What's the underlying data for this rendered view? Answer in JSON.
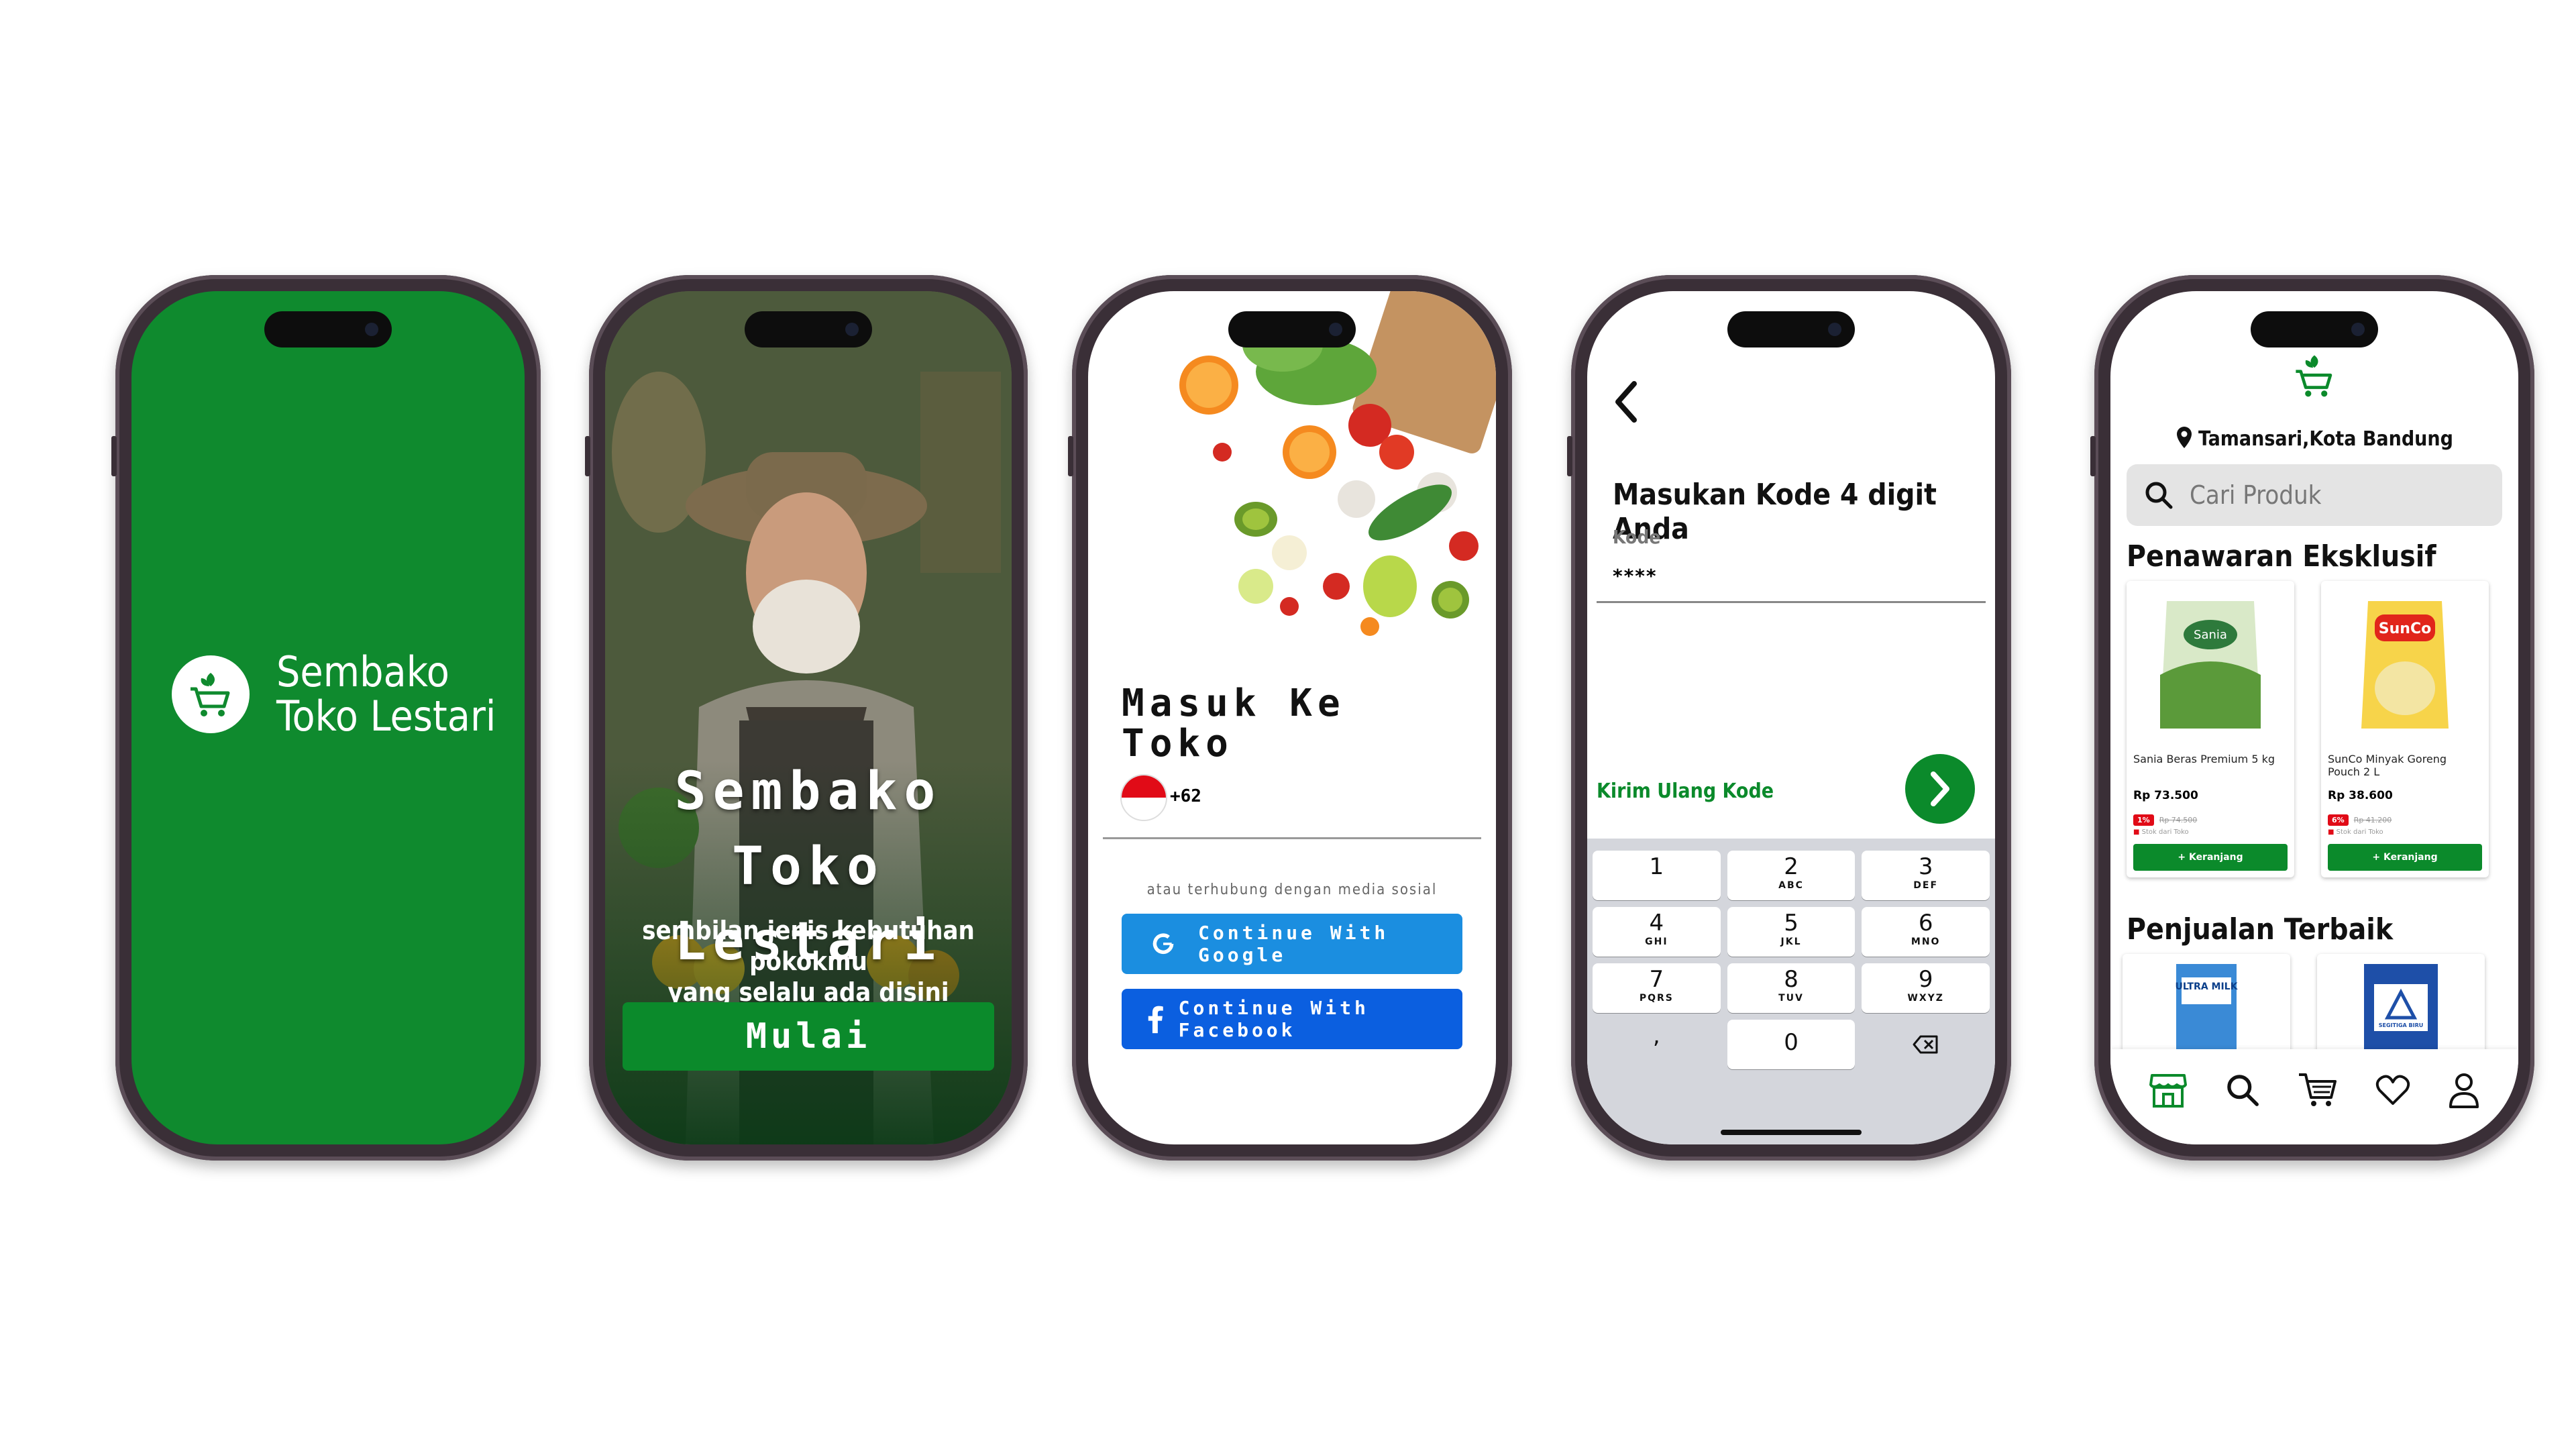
{
  "splash": {
    "brand_line1": "Sembako",
    "brand_line2": "Toko Lestari",
    "logo_icon": "cart-leaf-icon"
  },
  "onboarding": {
    "title_line1": "Sembako",
    "title_line2": "Toko Lestari",
    "subtitle_line1": "sembilan jenis kebutuhan pokokmu",
    "subtitle_line2": "yang selalu ada disini",
    "start_button": "Mulai"
  },
  "login": {
    "title_line1": "Masuk Ke",
    "title_line2": "Toko",
    "country_code": "+62",
    "social_hint": "atau terhubung dengan media sosial",
    "google_button": "Continue With Google",
    "facebook_button": "Continue With Facebook"
  },
  "otp": {
    "title": "Masukan Kode 4 digit Anda",
    "field_label": "Kode",
    "field_value": "****",
    "resend": "Kirim Ulang Kode",
    "keys": [
      [
        {
          "d": "1",
          "l": ""
        },
        {
          "d": "2",
          "l": "ABC"
        },
        {
          "d": "3",
          "l": "DEF"
        }
      ],
      [
        {
          "d": "4",
          "l": "GHI"
        },
        {
          "d": "5",
          "l": "JKL"
        },
        {
          "d": "6",
          "l": "MNO"
        }
      ],
      [
        {
          "d": "7",
          "l": "PQRS"
        },
        {
          "d": "8",
          "l": "TUV"
        },
        {
          "d": "9",
          "l": "WXYZ"
        }
      ]
    ],
    "zero": "0",
    "comma": ","
  },
  "home": {
    "location": "Tamansari,Kota Bandung",
    "search_placeholder": "Cari Produk",
    "section_exclusive": "Penawaran Eksklusif",
    "section_best": "Penjualan Terbaik",
    "products": [
      {
        "name": "Sania Beras Premium 5 kg",
        "price": "Rp 73.500",
        "disc": "1%",
        "old": "Rp 74.500",
        "stock": "Stok dari Toko",
        "add": "+ Keranjang"
      },
      {
        "name": "SunCo Minyak Goreng Pouch 2 L",
        "price": "Rp 38.600",
        "disc": "6%",
        "old": "Rp 41.200",
        "stock": "Stok dari Toko",
        "add": "+ Keranjang"
      }
    ],
    "best_labels": [
      "ULTRA MILK",
      "SEGITIGA BIRU"
    ],
    "nav_icons": [
      "store-icon",
      "search-icon",
      "cart-icon",
      "heart-icon",
      "user-icon"
    ]
  },
  "colors": {
    "brand_green": "#0b8a2b",
    "google_blue": "#1b8ee0",
    "facebook_blue": "#0b5fe0",
    "discount_red": "#e10b17"
  }
}
